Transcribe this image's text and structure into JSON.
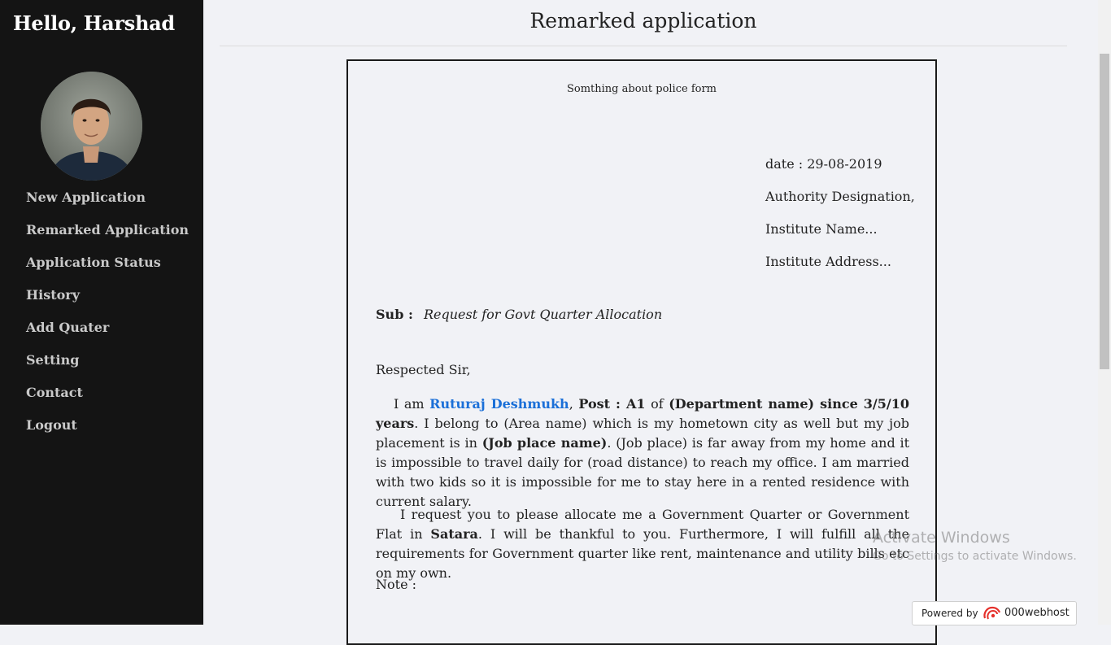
{
  "sidebar": {
    "greeting": "Hello, Harshad",
    "avatar_icon": "user-avatar-photo",
    "nav": [
      {
        "label": "New Application"
      },
      {
        "label": "Remarked Application"
      },
      {
        "label": "Application Status"
      },
      {
        "label": "History"
      },
      {
        "label": "Add Quater"
      },
      {
        "label": "Setting"
      },
      {
        "label": "Contact"
      },
      {
        "label": "Logout"
      }
    ]
  },
  "main": {
    "title": "Remarked application",
    "letter": {
      "header": "Somthing about police form",
      "date": "date : 29-08-2019",
      "authority": "Authority Designation,",
      "institute_name": "Institute Name...",
      "institute_address": "Institute Address...",
      "subject_label": "Sub :",
      "subject_text": "Request for Govt Quarter Allocation",
      "salutation": "Respected Sir,",
      "p1": {
        "t1": "I am ",
        "name": "Ruturaj Deshmukh",
        "t2": ", ",
        "post": "Post : A1",
        "t3": " of ",
        "dept": "(Department name) since 3/5/10 years",
        "t4": ". I belong to (Area name) which is my hometown city as well but my job placement is in ",
        "job": "(Job place name)",
        "t5": ". (Job place) is far away from my home and it is impossible to travel daily for (road distance) to reach my office. I am married with two kids so it is impossible for me to stay here in a rented residence with current salary."
      },
      "p2": {
        "t1": "I request you to please allocate me a Government Quarter or Government Flat in ",
        "city": "Satara",
        "t2": ". I will be thankful to you. Furthermore, I will fulfill all the requirements for Government quarter like rent, maintenance and utility bills etc on my own."
      },
      "note": "Note :"
    }
  },
  "watermark": {
    "line1": "Activate Windows",
    "line2": "Go to Settings to activate Windows."
  },
  "powered_by": {
    "text": "Powered by",
    "brand": "000webhost",
    "icon": "000webhost-logo-icon"
  },
  "colors": {
    "sidebar_bg": "#141414",
    "page_bg": "#f1f2f6",
    "link": "#1a6fd8"
  }
}
